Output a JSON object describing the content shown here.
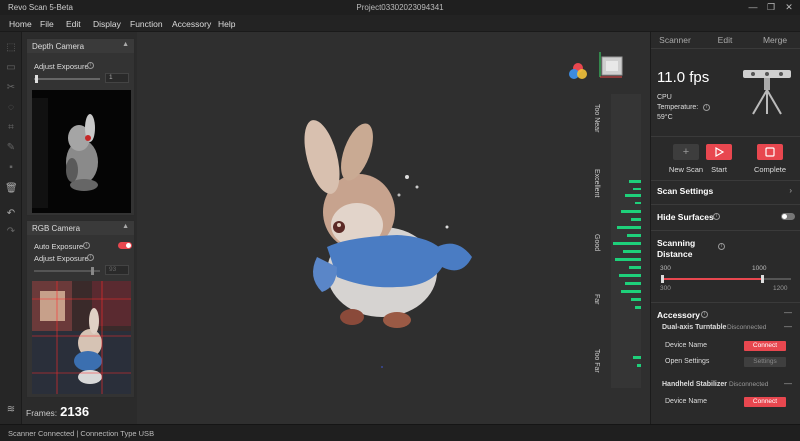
{
  "window": {
    "app_title": "Revo Scan 5-Beta",
    "project_title": "Project03302023094341",
    "minimize": "—",
    "restore": "❐",
    "close": "✕"
  },
  "menu": [
    "Home",
    "File",
    "Edit",
    "Display",
    "Function",
    "Accessory",
    "Help"
  ],
  "tools": [
    "select-icon",
    "box-select-icon",
    "cut-icon",
    "lasso-icon",
    "crop-icon",
    "brush-icon",
    "fill-icon",
    "delete-icon",
    "undo-icon",
    "redo-icon",
    "layers-icon"
  ],
  "depth_camera": {
    "title": "Depth Camera",
    "adjust_exposure_label": "Adjust Exposure",
    "exposure_value": "1",
    "exposure_level": 0.02
  },
  "rgb_camera": {
    "title": "RGB Camera",
    "auto_exposure_label": "Auto Exposure",
    "auto_exposure_on": true,
    "adjust_exposure_label": "Adjust Exposure",
    "exposure_value": "93",
    "exposure_level": 0.9
  },
  "frames": {
    "label": "Frames:",
    "value": "2136"
  },
  "distance_meter": {
    "labels": [
      "Too Near",
      "Excellent",
      "Good",
      "Far",
      "Too Far"
    ]
  },
  "status": {
    "text": "Scanner Connected | Connection Type USB"
  },
  "right_panel": {
    "tabs": [
      "Scanner",
      "Edit",
      "Merge"
    ],
    "active_tab": 0,
    "fps": "11.0 fps",
    "cpu_label": "CPU",
    "temperature_label": "Temperature:",
    "temperature_value": "59°C",
    "buttons": {
      "new_scan": "New Scan",
      "start": "Start",
      "complete": "Complete"
    },
    "scan_settings": "Scan Settings",
    "hide_surfaces": "Hide Surfaces",
    "hide_surfaces_on": false,
    "scanning_distance": "Scanning Distance",
    "distance_min_value": "300",
    "distance_max_value": "1000",
    "distance_range_min": "300",
    "distance_range_max": "1200",
    "accessory": {
      "title": "Accessory",
      "turntable": {
        "name": "Dual-axis Turntable",
        "status": "Disconnected",
        "device_name_label": "Device Name",
        "connect_label": "Connect",
        "open_settings_label": "Open Settings",
        "settings_label": "Settings"
      },
      "stabilizer": {
        "name": "Handheld Stabilizer",
        "status": "Disconnected",
        "device_name_label": "Device Name",
        "connect_label": "Connect"
      }
    }
  },
  "colors": {
    "accent_red": "#e8474f",
    "meter_green": "#1ed07a"
  }
}
